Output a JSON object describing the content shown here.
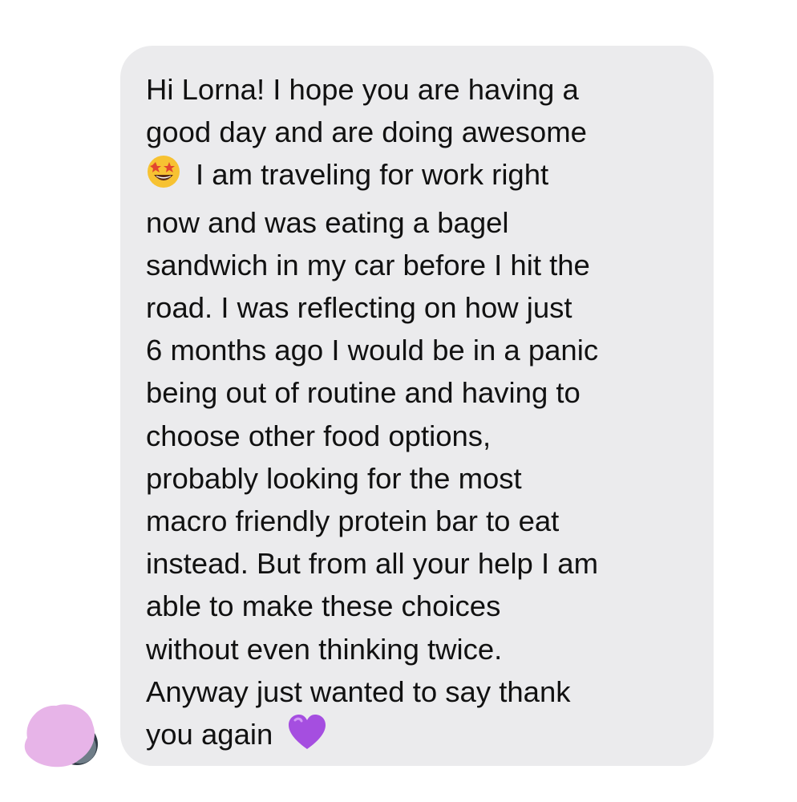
{
  "message": {
    "lines": [
      "Hi Lorna! I hope you are having a",
      "good day and are doing awesome",
      "I am traveling for work right",
      "now and was eating a bagel",
      "sandwich in my car before I hit the",
      "road. I was reflecting on how just",
      "6 months ago I would be in a panic",
      "being out of routine and having to",
      "choose other food options,",
      "probably looking for the most",
      "macro friendly protein bar to eat",
      "instead. But from all your help I am",
      "able to make these choices",
      "without even thinking twice.",
      "Anyway just wanted to say thank",
      "you again"
    ],
    "emoji_inline": "star-struck-emoji",
    "emoji_trailing": "purple-heart-emoji"
  },
  "colors": {
    "bubble": "#ebebed",
    "text": "#111111",
    "avatar_cover": "#e7b4e8",
    "heart": "#a54ee0"
  }
}
